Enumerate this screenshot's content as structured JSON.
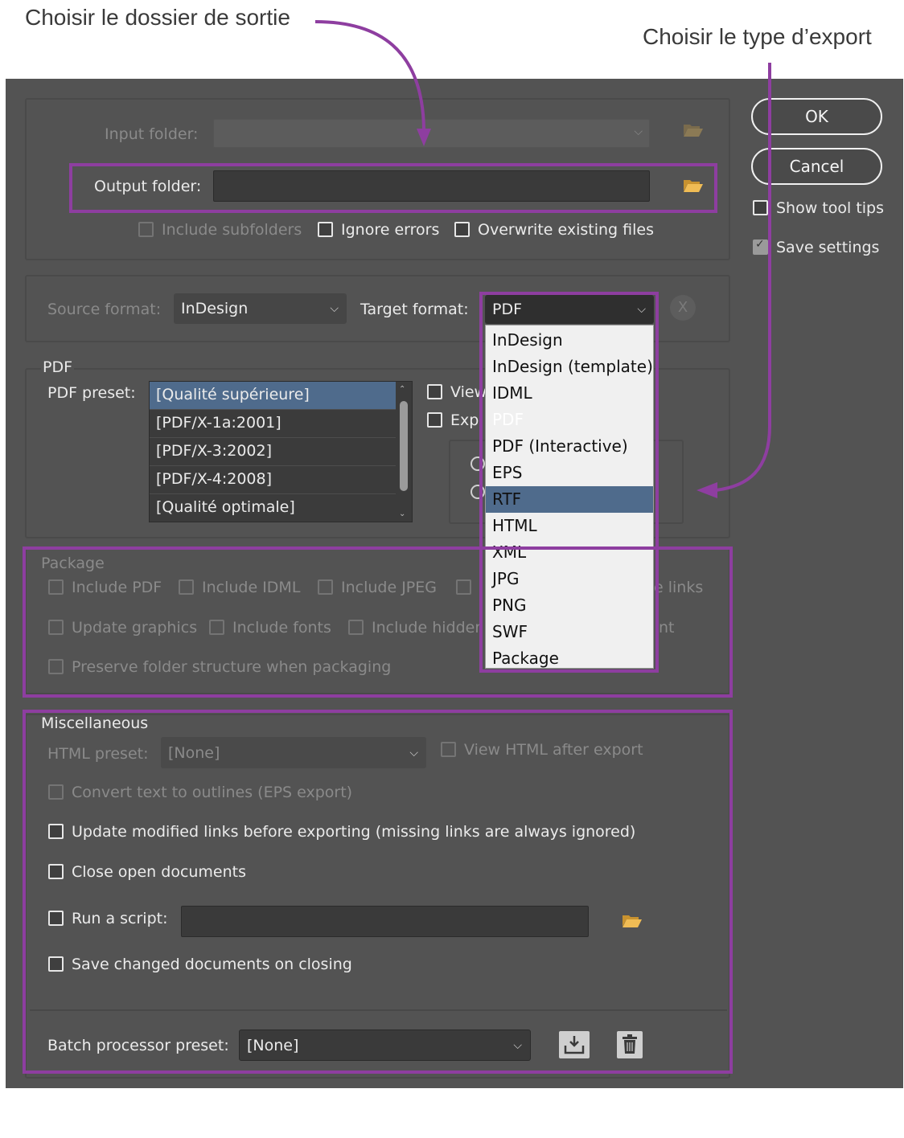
{
  "annotations": {
    "output_folder_callout": "Choisir le dossier de sortie",
    "export_type_callout": "Choisir le type d’export",
    "highlight_color": "#8e3ea0"
  },
  "colors": {
    "dialog_bg": "#535353",
    "field_bg": "#3a3a3a",
    "selection": "#4f6b8c",
    "folder_icon": "#e7b24a"
  },
  "folders": {
    "input_label": "Input folder:",
    "output_label": "Output folder:",
    "output_value": "",
    "include_subfolders": "Include subfolders",
    "ignore_errors": "Ignore errors",
    "overwrite_existing": "Overwrite existing files"
  },
  "buttons": {
    "ok": "OK",
    "cancel": "Cancel",
    "show_tool_tips": "Show tool tips",
    "save_settings": "Save settings"
  },
  "format": {
    "source_label": "Source format:",
    "source_value": "InDesign",
    "target_label": "Target format:",
    "target_value": "PDF",
    "clear_glyph": "X",
    "target_options": [
      "InDesign",
      "InDesign (template)",
      "IDML",
      "PDF",
      "PDF (Interactive)",
      "EPS",
      "RTF",
      "HTML",
      "XML",
      "JPG",
      "PNG",
      "SWF",
      "Package"
    ],
    "selected_option": "PDF"
  },
  "pdf": {
    "group_title": "PDF",
    "preset_label": "PDF preset:",
    "presets": [
      "[Qualité supérieure]",
      "[PDF/X-1a:2001]",
      "[PDF/X-3:2002]",
      "[PDF/X-4:2008]",
      "[Qualité optimale]"
    ],
    "view_partial": "View",
    "export_partial": "Exp"
  },
  "package": {
    "group_title": "Package",
    "include_pdf": "Include PDF",
    "include_idml": "Include IDML",
    "include_jpeg": "Include JPEG",
    "links_partial": "e links",
    "update_graphics": "Update graphics",
    "include_fonts": "Include fonts",
    "include_hidden_partial": "Include hidder",
    "nt_partial": "nt",
    "preserve_folder": "Preserve folder structure when packaging"
  },
  "misc": {
    "group_title": "Miscellaneous",
    "html_preset_label": "HTML preset:",
    "html_preset_value": "[None]",
    "view_html": "View HTML after export",
    "convert_outlines": "Convert text to outlines (EPS export)",
    "update_links": "Update modified links before exporting (missing links are always ignored)",
    "close_docs": "Close open documents",
    "run_script": "Run a script:",
    "save_changed": "Save changed documents on closing"
  },
  "batch": {
    "preset_label": "Batch processor preset:",
    "preset_value": "[None]"
  }
}
